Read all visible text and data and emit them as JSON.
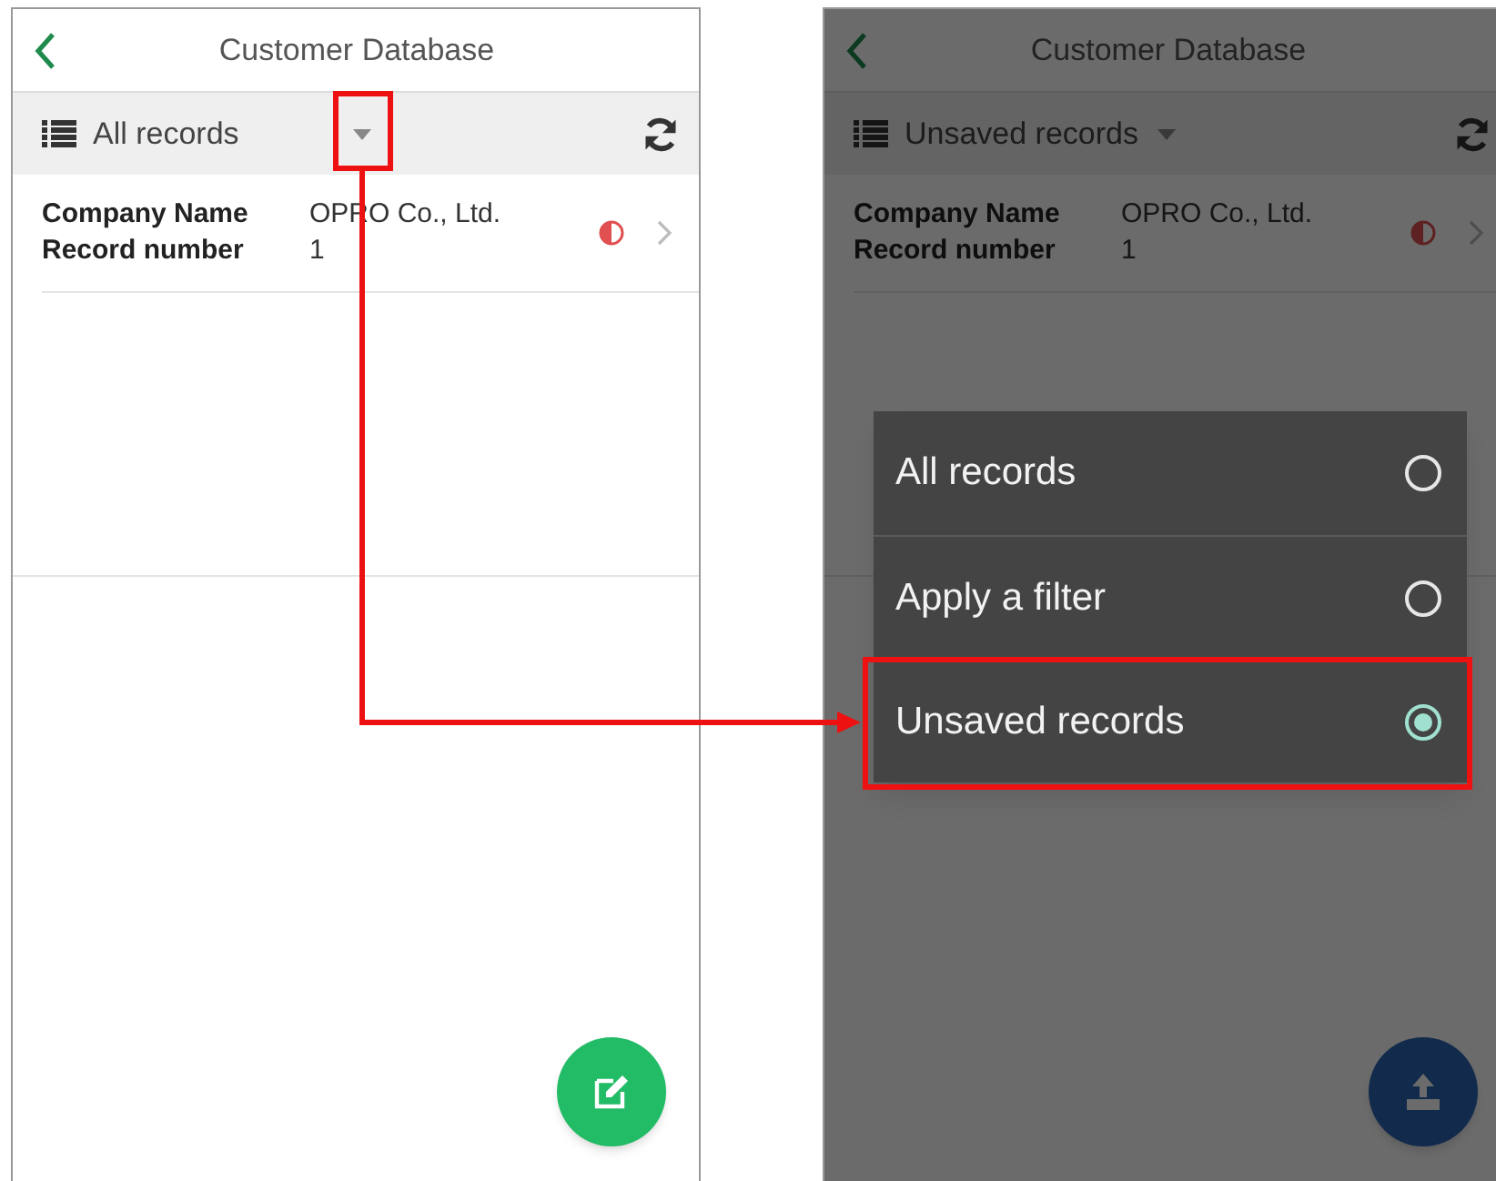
{
  "screens": [
    {
      "title": "Customer Database",
      "filter": "All records",
      "records": [
        {
          "fields": [
            {
              "label": "Company Name",
              "value": "OPRO Co., Ltd."
            },
            {
              "label": "Record number",
              "value": "1"
            }
          ]
        }
      ],
      "fab": {
        "kind": "edit"
      },
      "dimmed": false
    },
    {
      "title": "Customer Database",
      "filter": "Unsaved records",
      "records": [
        {
          "fields": [
            {
              "label": "Company Name",
              "value": "OPRO Co., Ltd."
            },
            {
              "label": "Record number",
              "value": "1"
            }
          ]
        }
      ],
      "fab": {
        "kind": "upload"
      },
      "dimmed": true,
      "menu": [
        {
          "label": "All records",
          "selected": false
        },
        {
          "label": "Apply a filter",
          "selected": false
        },
        {
          "label": "Unsaved records",
          "selected": true
        }
      ]
    }
  ]
}
